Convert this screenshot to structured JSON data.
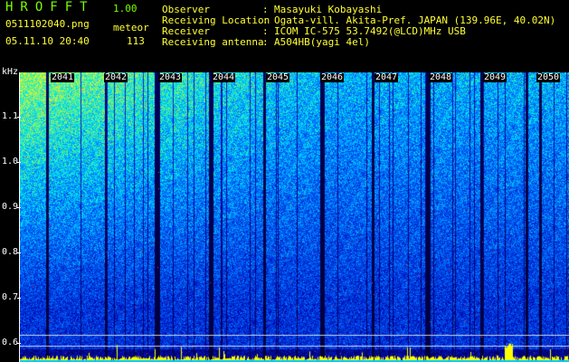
{
  "header": {
    "app_title": "HROFFT",
    "app_version": "1.00",
    "file_name": "0511102040.png",
    "meteor_label": "meteor",
    "datetime": "05.11.10 20:40",
    "meteor_count": "113"
  },
  "station_info": [
    {
      "key": "Observer",
      "value": "Masayuki Kobayashi"
    },
    {
      "key": "Receiving Location",
      "value": "Ogata-vill. Akita-Pref. JAPAN (139.96E, 40.02N)"
    },
    {
      "key": "Receiver",
      "value": "ICOM IC-575 53.7492(@LCD)MHz USB"
    },
    {
      "key": "Receiving antenna",
      "value": "A504HB(yagi 4el)"
    }
  ],
  "spectrogram": {
    "frequency_unit": "kHz",
    "y_ticks": [
      "1.1",
      "1.0",
      "0.9",
      "0.8",
      "0.7",
      "0.6"
    ],
    "time_ticks": [
      "2041",
      "2042",
      "2043",
      "2044",
      "2045",
      "2046",
      "2047",
      "2048",
      "2049",
      "2050"
    ],
    "colors": {
      "background": "#000000",
      "noise_low": "#001a80",
      "noise_mid": "#0055ff",
      "noise_high": "#00c8ff",
      "signal": "#ffff00",
      "band": "#ff3300"
    }
  }
}
